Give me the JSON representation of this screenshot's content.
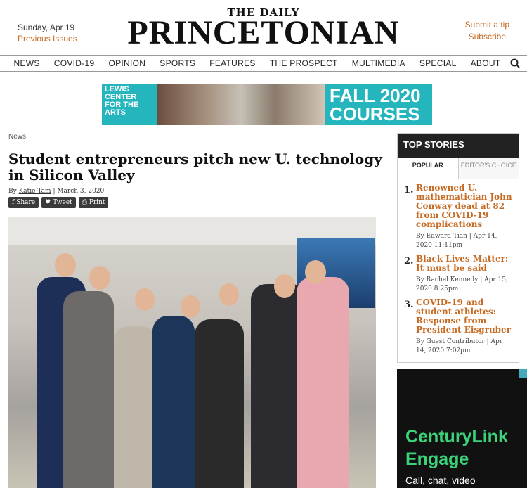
{
  "header": {
    "date": "Sunday, Apr 19",
    "previous_issues": "Previous Issues",
    "submit_tip": "Submit a tip",
    "subscribe": "Subscribe",
    "masthead_small": "THE DAILY",
    "masthead_big": "PRINCETONIAN"
  },
  "nav": {
    "items": [
      "NEWS",
      "COVID-19",
      "OPINION",
      "SPORTS",
      "FEATURES",
      "THE PROSPECT",
      "MULTIMEDIA",
      "SPECIAL",
      "ABOUT"
    ],
    "search_icon": "search-icon"
  },
  "banner": {
    "left_text": "LEWIS CENTER FOR THE ARTS",
    "right_text": "FALL 2020 COURSES",
    "color": "#25b6bd"
  },
  "article": {
    "section": "News",
    "headline": "Student entrepreneurs pitch new U. technology in Silicon Valley",
    "by": "By",
    "author": "Katie Tam",
    "date": "| March 3, 2020",
    "share": "Share",
    "tweet": "Tweet",
    "print": "Print"
  },
  "sidebar": {
    "title": "TOP STORIES",
    "tabs": [
      "POPULAR",
      "EDITOR'S CHOICE"
    ],
    "stories": [
      {
        "num": "1.",
        "title": "Renowned U. mathematician John Conway dead at 82 from COVID-19 complications",
        "meta": "By Edward Tian | Apr 14, 2020 11:11pm"
      },
      {
        "num": "2.",
        "title": "Black Lives Matter: It must be said",
        "meta": "By Rachel Kennedy | Apr 15, 2020 8:25pm"
      },
      {
        "num": "3.",
        "title": "COVID-19 and student athletes: Response from President Eisgruber",
        "meta": "By Guest Contributor | Apr 14, 2020 7:02pm"
      }
    ]
  },
  "ad": {
    "brand_line1": "CenturyLink",
    "brand_line2": "Engage",
    "tagline": "Call, chat, video"
  },
  "colors": {
    "accent": "#c76b23",
    "ad_green": "#3cd27a"
  }
}
